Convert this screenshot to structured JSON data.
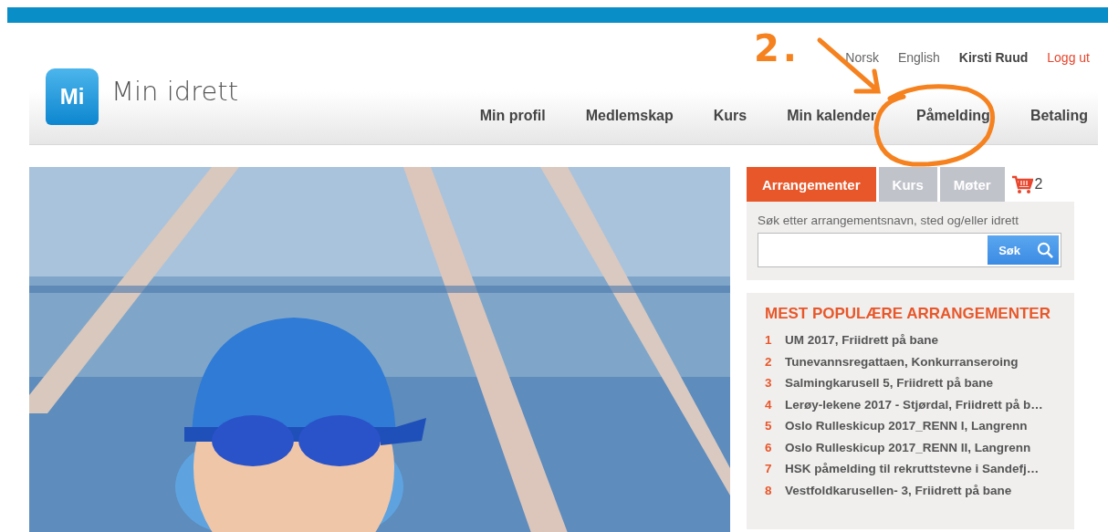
{
  "header": {
    "logo_mark": "Mi",
    "logo_text": "Min idrett",
    "top_links": [
      {
        "label": "Norsk",
        "kind": "lang"
      },
      {
        "label": "English",
        "kind": "lang"
      },
      {
        "label": "Kirsti Ruud",
        "kind": "user"
      },
      {
        "label": "Logg ut",
        "kind": "logout"
      }
    ],
    "nav": [
      {
        "label": "Min profil",
        "selected": false
      },
      {
        "label": "Medlemskap",
        "selected": false
      },
      {
        "label": "Kurs",
        "selected": false
      },
      {
        "label": "Min kalender",
        "selected": false
      },
      {
        "label": "Påmelding",
        "selected": false
      },
      {
        "label": "Betaling",
        "selected": false
      }
    ]
  },
  "annotation": {
    "label": "2."
  },
  "sidebar": {
    "tabs": [
      {
        "label": "Arrangementer",
        "selected": true
      },
      {
        "label": "Kurs",
        "selected": false
      },
      {
        "label": "Møter",
        "selected": false
      }
    ],
    "cart_count": "2",
    "search": {
      "label": "Søk etter arrangementsnavn, sted og/eller idrett",
      "button": "Søk"
    },
    "popular": {
      "title": "MEST POPULÆRE ARRANGEMENTER",
      "items": [
        {
          "rank": "1",
          "name": "UM 2017, Friidrett på bane"
        },
        {
          "rank": "2",
          "name": "Tunevannsregattaen, Konkurranseroing"
        },
        {
          "rank": "3",
          "name": "Salmingkarusell 5, Friidrett på bane"
        },
        {
          "rank": "4",
          "name": "Lerøy-lekene 2017 - Stjørdal, Friidrett på b…"
        },
        {
          "rank": "5",
          "name": "Oslo Rulleskicup 2017_RENN I, Langrenn"
        },
        {
          "rank": "6",
          "name": "Oslo Rulleskicup 2017_RENN II, Langrenn"
        },
        {
          "rank": "7",
          "name": "HSK påmelding til rekruttstevne i Sandefj…"
        },
        {
          "rank": "8",
          "name": "Vestfoldkarusellen- 3, Friidrett på bane"
        }
      ]
    }
  }
}
